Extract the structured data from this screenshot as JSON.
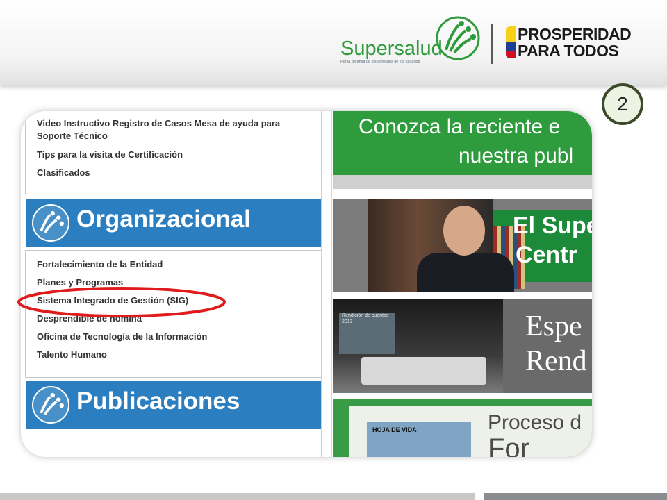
{
  "header": {
    "supersalud": {
      "wordmark": "Supersalud",
      "tagline": "Por la defensa de los derechos de los usuarios"
    },
    "prosperidad": {
      "line1": "PROSPERIDAD",
      "line2": "PARA TODOS"
    }
  },
  "badge": {
    "number": "2"
  },
  "left_panel": {
    "top_links": [
      "Video Instructivo Registro de Casos Mesa de ayuda para Soporte Técnico",
      "Tips para la visita de Certificación",
      "Clasificados"
    ],
    "org_section": {
      "title": "Organizacional",
      "links": [
        "Fortalecimiento de la Entidad",
        "Planes y Programas",
        "Sistema Integrado de Gestión (SIG)",
        "Desprendible de nómina",
        "Oficina de Tecnología de la Información",
        "Talento Humano"
      ]
    },
    "pub_section": {
      "title": "Publicaciones"
    }
  },
  "right_panel": {
    "tile1": {
      "line1": "Conozca la reciente e",
      "line2": "nuestra publ"
    },
    "tile2": {
      "line1": "El Supe",
      "line2": "Centr"
    },
    "tile3": {
      "screen_line1": "Rendición de cuentas",
      "screen_line2": "2013",
      "line1": "Espe",
      "line2": "Rend"
    },
    "tile4": {
      "doc_label": "HOJA DE VIDA",
      "line1": "Proceso d",
      "line2": "For"
    }
  },
  "colors": {
    "green": "#2e9c3d",
    "blue": "#2b7fc0",
    "highlight_red": "#e01b1b"
  }
}
